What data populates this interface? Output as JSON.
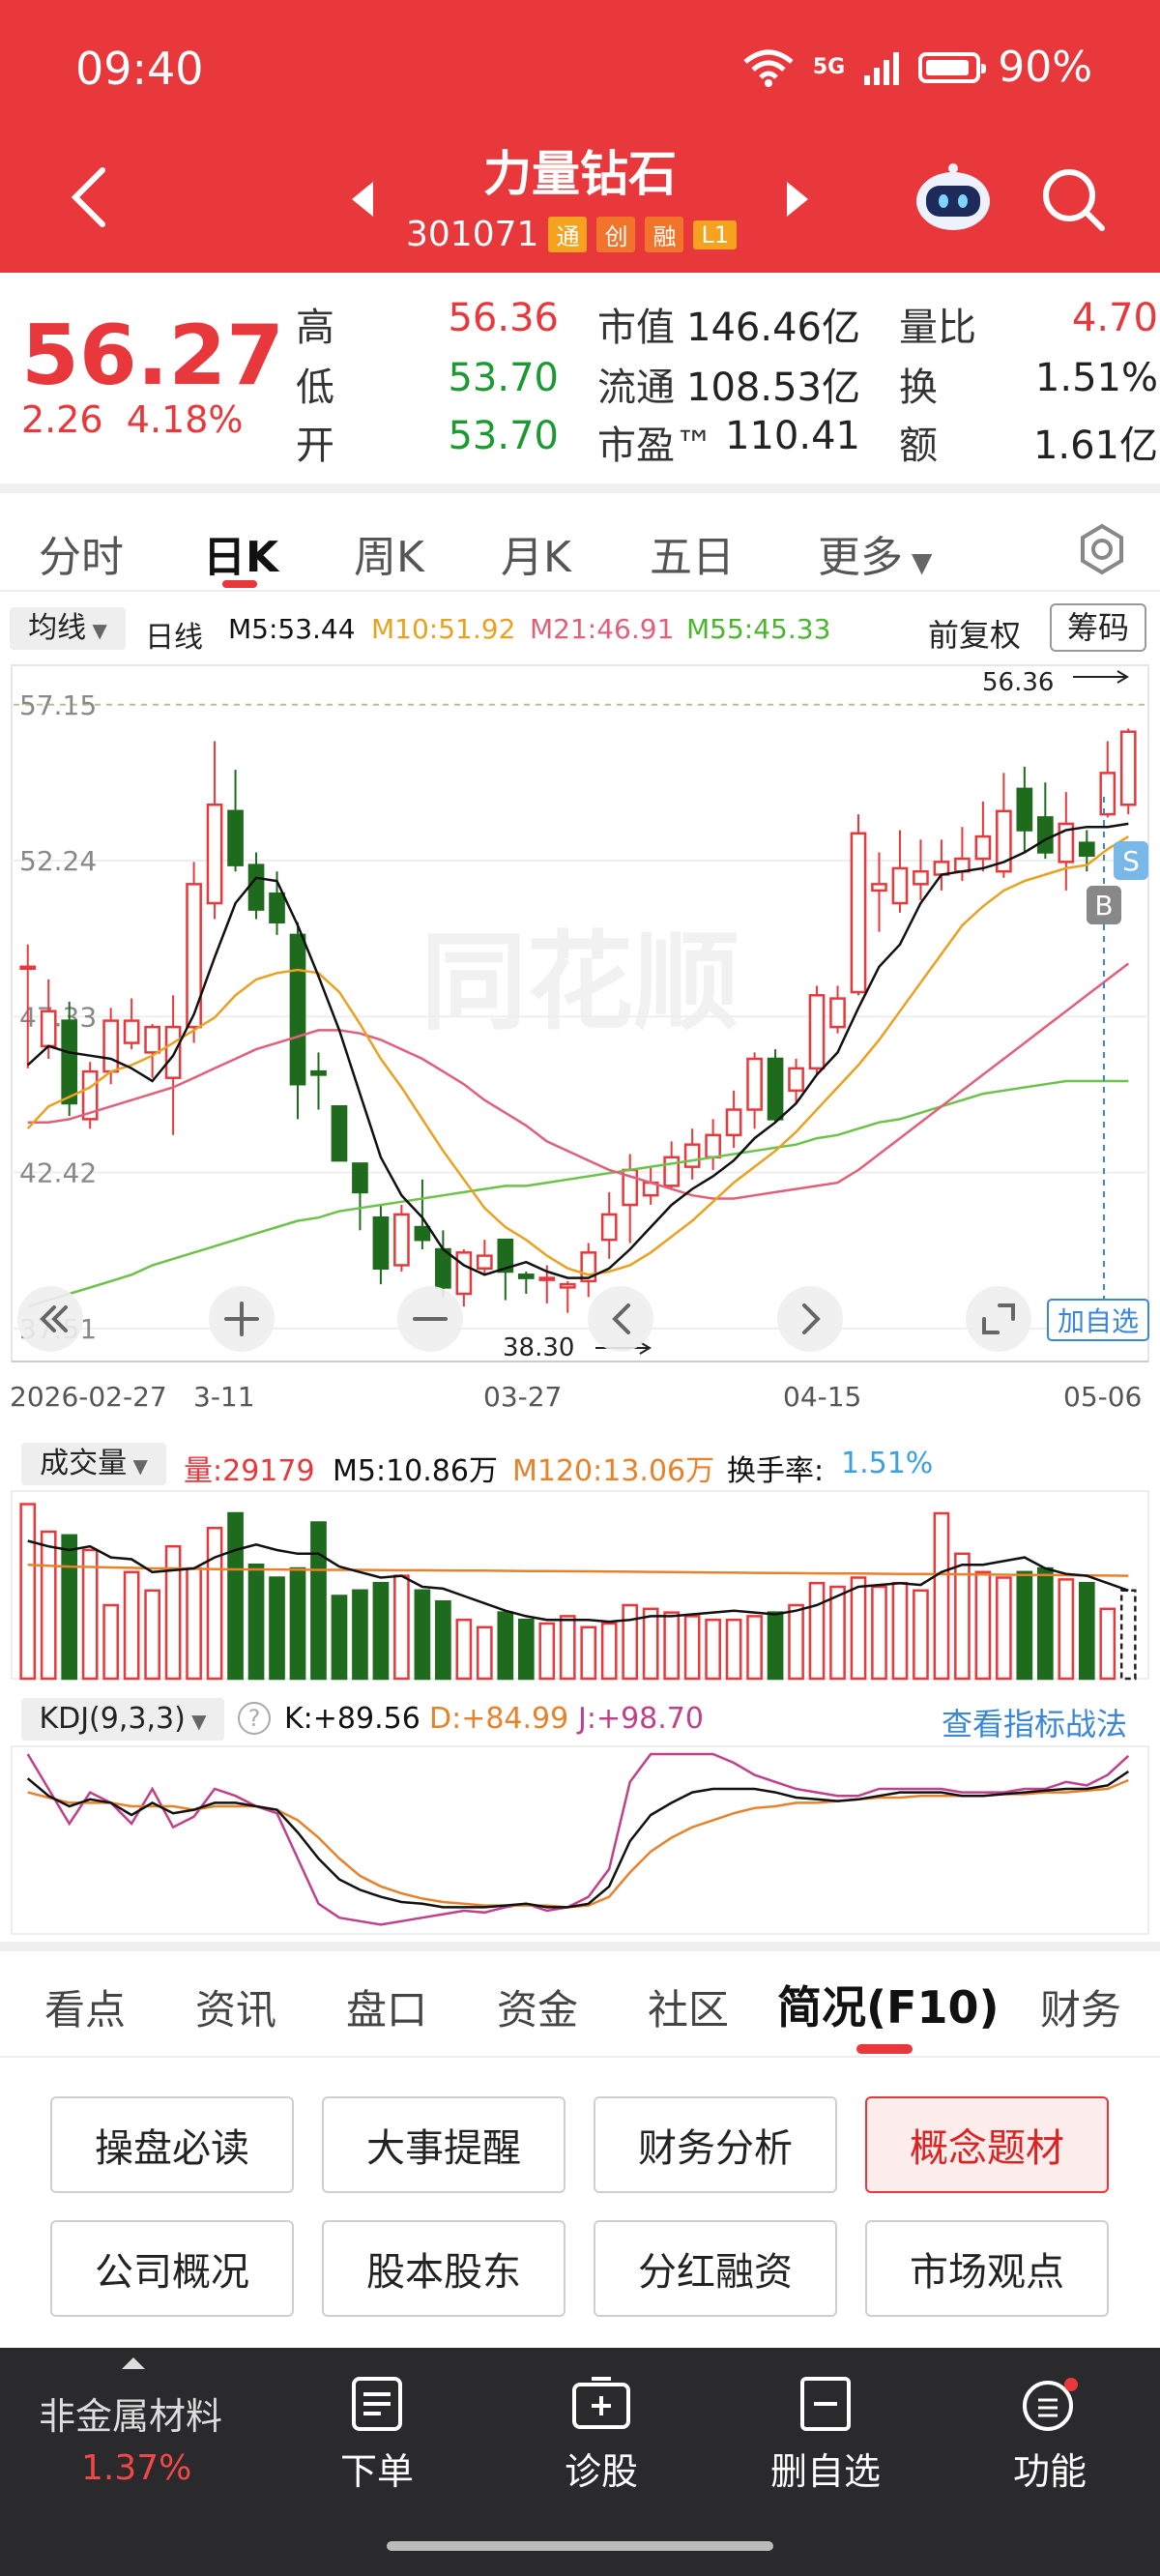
{
  "status_bar": {
    "time": "09:40",
    "network": "5G",
    "battery": "90%"
  },
  "header": {
    "title": "力量钻石",
    "code": "301071",
    "tags": [
      "通",
      "创",
      "融",
      "L1"
    ]
  },
  "quote": {
    "price": "56.27",
    "change": "2.26",
    "change_pct": "4.18%",
    "rows": [
      {
        "l1": "高",
        "v1": "56.36",
        "l2": "市值",
        "v2": "146.46亿",
        "l3": "量比",
        "v3": "4.70"
      },
      {
        "l1": "低",
        "v1": "53.70",
        "l2": "流通",
        "v2": "108.53亿",
        "l3": "换",
        "v3": "1.51%"
      },
      {
        "l1": "开",
        "v1": "53.70",
        "l2": "市盈™",
        "v2": "110.41",
        "l3": "额",
        "v3": "1.61亿"
      }
    ]
  },
  "k_tabs": [
    "分时",
    "日K",
    "周K",
    "月K",
    "五日",
    "更多"
  ],
  "k_active": "日K",
  "ma_bar": {
    "selector": "均线",
    "period": "日线",
    "m5": "M5:53.44",
    "m10": "M10:51.92",
    "m21": "M21:46.91",
    "m55": "M55:45.33",
    "adjust": "前复权",
    "chips": "筹码"
  },
  "colors": {
    "up": "#e8383c",
    "down": "#1e6b1e",
    "m5": "#111111",
    "m10": "#e8a220",
    "m21": "#e0607a",
    "m55": "#6cc24a",
    "accent": "#e8383c"
  },
  "price_chart": {
    "y_labels": [
      "57.15",
      "52.24",
      "47.33",
      "42.42",
      "37.51"
    ],
    "x_labels": [
      "2026-02-27",
      "3-11",
      "03-27",
      "04-15",
      "05-06"
    ],
    "high_marker": "56.36",
    "low_marker": "38.30",
    "badges": {
      "s": "S",
      "b": "B"
    },
    "add_watchlist": "加自选",
    "watermark": "同花顺"
  },
  "chart_data": {
    "type": "candlestick",
    "ylim": [
      37.51,
      57.15
    ],
    "candles": [
      [
        48.9,
        48.9,
        46.2,
        45.7,
        49.6
      ],
      [
        46.4,
        47.5,
        46.2,
        46.0,
        48.5
      ],
      [
        47.2,
        44.6,
        44.4,
        44.2,
        47.8
      ],
      [
        44.1,
        45.6,
        44.0,
        43.8,
        45.9
      ],
      [
        45.6,
        47.2,
        45.2,
        45.3,
        47.6
      ],
      [
        46.5,
        47.2,
        46.3,
        46.3,
        47.9
      ],
      [
        46.2,
        47.0,
        45.8,
        45.4,
        47.1
      ],
      [
        45.4,
        47.0,
        45.2,
        43.6,
        48.0
      ],
      [
        47.0,
        51.5,
        46.6,
        46.5,
        52.2
      ],
      [
        50.9,
        54.0,
        50.8,
        50.4,
        56.0
      ],
      [
        53.8,
        52.1,
        51.9,
        51.9,
        55.1
      ],
      [
        52.1,
        50.7,
        50.4,
        50.6,
        52.5
      ],
      [
        51.2,
        50.3,
        50.0,
        49.9,
        51.9
      ],
      [
        49.9,
        45.2,
        44.2,
        44.1,
        50.3
      ],
      [
        45.6,
        45.5,
        44.4,
        44.7,
        46.2
      ],
      [
        44.5,
        42.8,
        43.4,
        42.8,
        44.3
      ],
      [
        42.7,
        41.8,
        40.6,
        41.8,
        42.5
      ],
      [
        41.0,
        39.4,
        39.8,
        38.9,
        41.4
      ],
      [
        39.5,
        41.1,
        39.3,
        39.9,
        41.4
      ],
      [
        40.7,
        40.3,
        40.0,
        40.0,
        42.2
      ],
      [
        40.0,
        38.8,
        38.6,
        38.5,
        40.6
      ],
      [
        38.6,
        39.9,
        38.3,
        38.2,
        40.0
      ],
      [
        39.4,
        39.8,
        39.2,
        39.6,
        40.3
      ],
      [
        40.3,
        39.3,
        38.4,
        38.5,
        40.3
      ],
      [
        39.2,
        39.1,
        38.7,
        38.6,
        39.3
      ],
      [
        39.1,
        39.1,
        38.8,
        38.3,
        39.5
      ],
      [
        38.8,
        38.9,
        38.0,
        38.5,
        39.0
      ],
      [
        39.0,
        39.9,
        38.9,
        38.5,
        40.2
      ],
      [
        40.3,
        41.1,
        39.7,
        39.8,
        41.8
      ],
      [
        41.4,
        42.5,
        41.3,
        40.2,
        43.0
      ],
      [
        41.7,
        42.1,
        41.6,
        41.4,
        42.6
      ],
      [
        42.0,
        42.9,
        42.0,
        41.9,
        43.4
      ],
      [
        42.6,
        43.3,
        42.5,
        42.2,
        43.8
      ],
      [
        42.9,
        43.6,
        42.6,
        42.5,
        44.1
      ],
      [
        43.6,
        44.4,
        43.6,
        43.2,
        45.0
      ],
      [
        44.4,
        46.0,
        43.9,
        43.8,
        46.2
      ],
      [
        46.0,
        44.1,
        44.0,
        44.0,
        46.3
      ],
      [
        45.0,
        45.7,
        44.8,
        44.6,
        46.0
      ],
      [
        45.7,
        48.0,
        45.6,
        45.5,
        48.3
      ],
      [
        47.0,
        47.9,
        46.9,
        46.8,
        48.3
      ],
      [
        48.1,
        53.1,
        48.0,
        48.0,
        53.7
      ],
      [
        51.3,
        51.5,
        51.2,
        50.0,
        52.5
      ],
      [
        50.9,
        52.0,
        50.8,
        50.6,
        53.2
      ],
      [
        51.5,
        51.9,
        51.3,
        51.0,
        52.9
      ],
      [
        51.8,
        52.2,
        51.6,
        51.3,
        52.9
      ],
      [
        51.9,
        52.3,
        51.8,
        51.6,
        53.3
      ],
      [
        52.3,
        53.0,
        52.4,
        51.9,
        54.1
      ],
      [
        51.9,
        53.8,
        51.9,
        51.7,
        55.0
      ],
      [
        54.5,
        53.2,
        52.9,
        52.5,
        55.2
      ],
      [
        53.6,
        52.5,
        53.2,
        52.3,
        54.7
      ],
      [
        52.2,
        53.4,
        52.3,
        51.3,
        54.4
      ],
      [
        52.8,
        52.4,
        53.0,
        51.9,
        53.2
      ],
      [
        53.7,
        55.0,
        53.6,
        53.6,
        56.0
      ],
      [
        54.0,
        56.3,
        53.7,
        53.7,
        56.4
      ]
    ],
    "ma5": [
      45.8,
      46.4,
      46.2,
      46.1,
      46.0,
      45.7,
      45.3,
      46.1,
      47.4,
      49.2,
      50.9,
      51.7,
      51.6,
      50.2,
      48.6,
      46.9,
      44.9,
      42.9,
      41.7,
      41.0,
      40.0,
      39.5,
      39.2,
      39.4,
      39.6,
      39.3,
      39.1,
      39.1,
      39.4,
      40.0,
      40.7,
      41.4,
      41.9,
      42.3,
      42.8,
      43.5,
      44.0,
      44.6,
      45.5,
      46.2,
      47.6,
      48.9,
      49.6,
      50.9,
      51.8,
      51.9,
      52.0,
      52.2,
      52.5,
      52.9,
      53.2,
      53.3,
      53.3,
      53.4
    ],
    "ma10": [
      43.8,
      44.5,
      44.8,
      45.1,
      45.6,
      45.8,
      46.1,
      46.5,
      46.9,
      47.3,
      48.0,
      48.5,
      48.7,
      48.8,
      48.7,
      48.1,
      47.1,
      46.0,
      45.1,
      44.1,
      43.1,
      42.2,
      41.3,
      40.7,
      40.3,
      39.8,
      39.4,
      39.2,
      39.3,
      39.5,
      39.9,
      40.4,
      40.9,
      41.5,
      42.1,
      42.6,
      43.1,
      43.7,
      44.4,
      45.1,
      45.8,
      46.6,
      47.5,
      48.4,
      49.3,
      50.2,
      50.8,
      51.3,
      51.6,
      51.8,
      52.0,
      52.1,
      52.6,
      53.0
    ],
    "ma21": [
      44.0,
      44.0,
      44.1,
      44.3,
      44.5,
      44.7,
      44.9,
      45.1,
      45.4,
      45.7,
      46.0,
      46.3,
      46.5,
      46.7,
      46.9,
      46.9,
      46.8,
      46.6,
      46.3,
      46.0,
      45.6,
      45.2,
      44.7,
      44.3,
      43.9,
      43.4,
      43.1,
      42.8,
      42.5,
      42.3,
      42.1,
      41.9,
      41.7,
      41.6,
      41.6,
      41.7,
      41.8,
      41.9,
      42.0,
      42.1,
      42.5,
      43.0,
      43.5,
      44.0,
      44.5,
      45.0,
      45.5,
      46.0,
      46.5,
      47.0,
      47.5,
      48.0,
      48.5,
      49.0
    ],
    "ma55": [
      38.2,
      38.4,
      38.6,
      38.8,
      39.0,
      39.2,
      39.5,
      39.7,
      39.9,
      40.1,
      40.3,
      40.5,
      40.7,
      40.9,
      41.0,
      41.2,
      41.3,
      41.4,
      41.5,
      41.6,
      41.7,
      41.8,
      41.9,
      42.0,
      42.0,
      42.1,
      42.2,
      42.3,
      42.4,
      42.5,
      42.6,
      42.7,
      42.8,
      42.9,
      43.0,
      43.1,
      43.2,
      43.3,
      43.5,
      43.6,
      43.8,
      44.0,
      44.1,
      44.3,
      44.5,
      44.7,
      44.9,
      45.0,
      45.1,
      45.2,
      45.3,
      45.3,
      45.3,
      45.3
    ],
    "volume": [
      95,
      80,
      78,
      70,
      40,
      58,
      48,
      72,
      60,
      82,
      90,
      62,
      55,
      60,
      85,
      45,
      48,
      52,
      56,
      48,
      42,
      32,
      28,
      36,
      32,
      30,
      34,
      28,
      30,
      40,
      38,
      36,
      34,
      32,
      32,
      34,
      36,
      40,
      52,
      50,
      55,
      50,
      52,
      48,
      90,
      68,
      58,
      55,
      58,
      60,
      54,
      52,
      38,
      48
    ],
    "volume_ma5": [
      75,
      72,
      70,
      72,
      66,
      65,
      58,
      59,
      60,
      66,
      70,
      73,
      70,
      68,
      68,
      61,
      58,
      55,
      56,
      50,
      49,
      45,
      41,
      37,
      34,
      32,
      32,
      32,
      31,
      32,
      34,
      34,
      35,
      36,
      37,
      36,
      35,
      37,
      40,
      45,
      50,
      51,
      52,
      51,
      58,
      62,
      62,
      64,
      66,
      60,
      57,
      56,
      52,
      48
    ],
    "volume_ma120": [
      62,
      61.5,
      61,
      60.8,
      60.5,
      60.3,
      60,
      60,
      59.8,
      59.6,
      59.5,
      59.5,
      59.4,
      59.3,
      59.2,
      59.2,
      59.2,
      59.1,
      59,
      59,
      58.9,
      58.8,
      58.8,
      58.7,
      58.6,
      58.6,
      58.5,
      58.4,
      58.3,
      58.2,
      58.1,
      58,
      57.9,
      57.8,
      57.7,
      57.6,
      57.5,
      57.4,
      57.3,
      57.2,
      57.2,
      57.1,
      57,
      57,
      56.9,
      56.8,
      56.7,
      56.6,
      56.5,
      56.4,
      56.3,
      56.2,
      56.1,
      56
    ],
    "kdj_k": [
      86,
      76,
      70,
      74,
      72,
      65,
      72,
      66,
      68,
      72,
      72,
      70,
      68,
      55,
      40,
      28,
      22,
      18,
      15,
      14,
      12,
      12,
      12,
      13,
      14,
      12,
      12,
      14,
      24,
      50,
      65,
      72,
      78,
      80,
      80,
      80,
      78,
      75,
      74,
      73,
      74,
      76,
      78,
      78,
      78,
      76,
      76,
      77,
      78,
      79,
      80,
      80,
      82,
      90
    ],
    "kdj_d": [
      78,
      75,
      72,
      72,
      72,
      70,
      70,
      70,
      68,
      70,
      70,
      70,
      68,
      62,
      52,
      40,
      30,
      24,
      20,
      17,
      15,
      14,
      13,
      13,
      13,
      13,
      12,
      13,
      18,
      32,
      44,
      52,
      58,
      62,
      66,
      69,
      70,
      72,
      72,
      73,
      74,
      75,
      75,
      76,
      76,
      76,
      76,
      77,
      77,
      78,
      78,
      79,
      80,
      85
    ],
    "kdj_j": [
      100,
      80,
      60,
      78,
      72,
      60,
      80,
      58,
      64,
      80,
      76,
      70,
      66,
      40,
      14,
      6,
      4,
      2,
      4,
      6,
      8,
      10,
      9,
      12,
      14,
      10,
      12,
      18,
      34,
      84,
      100,
      100,
      100,
      100,
      95,
      88,
      84,
      80,
      78,
      76,
      76,
      80,
      80,
      80,
      80,
      78,
      78,
      78,
      80,
      80,
      84,
      82,
      88,
      99
    ]
  },
  "volume_bar": {
    "selector": "成交量",
    "vol": "量:29179",
    "m5": "M5:10.86万",
    "m120": "M120:13.06万",
    "turnover_label": "换手率:",
    "turnover": "1.51%"
  },
  "kdj_bar": {
    "selector": "KDJ(9,3,3)",
    "help": "?",
    "k": "K:+89.56",
    "d": "D:+84.99",
    "j": "J:+98.70",
    "link": "查看指标战法"
  },
  "section_tabs": [
    "看点",
    "资讯",
    "盘口",
    "资金",
    "社区",
    "简况(F10)",
    "财务"
  ],
  "section_active": "简况(F10)",
  "f10_buttons": [
    "操盘必读",
    "大事提醒",
    "财务分析",
    "概念题材",
    "公司概况",
    "股本股东",
    "分红融资",
    "市场观点"
  ],
  "f10_highlight": "概念题材",
  "bottom_bar": {
    "sector": "非金属材料",
    "sector_pct": "1.37%",
    "items": [
      "下单",
      "诊股",
      "删自选",
      "功能"
    ]
  }
}
